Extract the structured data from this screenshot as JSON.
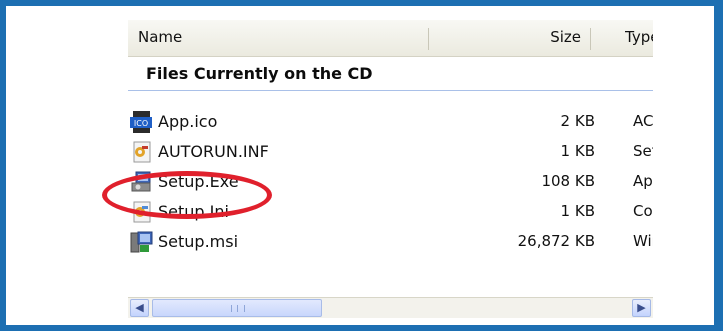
{
  "columns": {
    "name": "Name",
    "size": "Size",
    "type": "Type"
  },
  "group_title": "Files Currently on the CD",
  "files": [
    {
      "name": "App.ico",
      "size": "2 KB",
      "type": "ACDSee",
      "icon": "ico-file-icon"
    },
    {
      "name": "AUTORUN.INF",
      "size": "1 KB",
      "type": "Setup Information",
      "icon": "inf-settings-icon"
    },
    {
      "name": "Setup.Exe",
      "size": "108 KB",
      "type": "Application",
      "icon": "setup-exe-icon"
    },
    {
      "name": "Setup.Ini",
      "size": "1 KB",
      "type": "Configuration Settings",
      "icon": "ini-settings-icon"
    },
    {
      "name": "Setup.msi",
      "size": "26,872 KB",
      "type": "Windows Installer Package",
      "icon": "msi-installer-icon"
    }
  ],
  "highlighted_file": "Setup.Exe",
  "colors": {
    "frame": "#1d6fb2",
    "highlight": "#e0202c",
    "group_line": "#a9c0e8"
  }
}
